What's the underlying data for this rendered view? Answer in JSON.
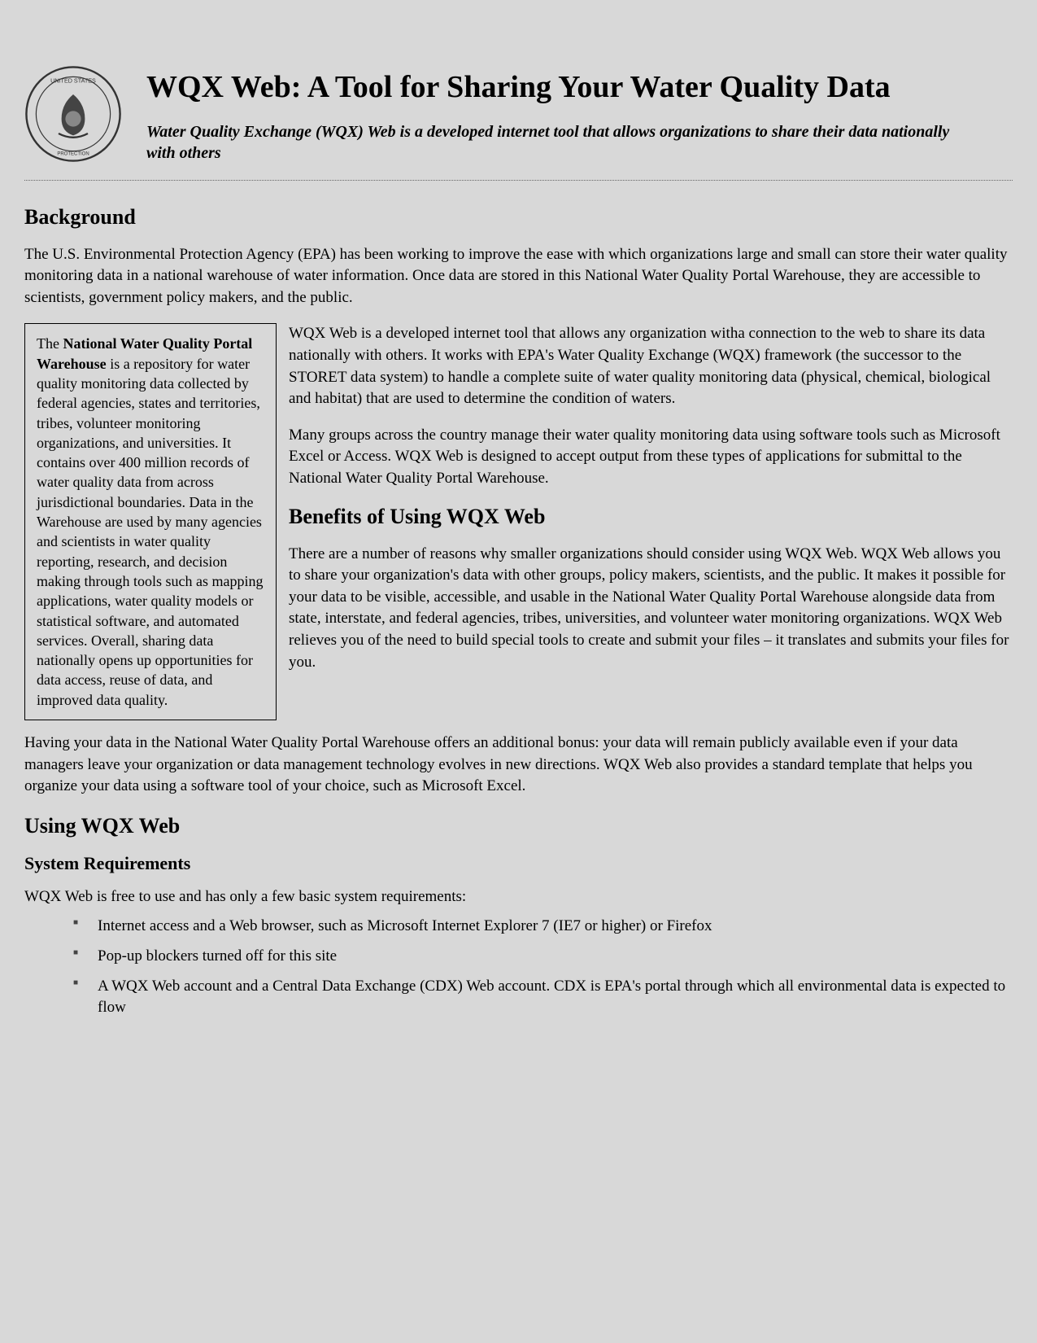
{
  "header": {
    "title": "WQX Web: A Tool for Sharing Your Water Quality Data",
    "subtitle": "Water Quality Exchange (WQX) Web is a developed internet tool that allows organizations to share their data nationally with others"
  },
  "background": {
    "heading": "Background",
    "intro": "The U.S. Environmental Protection Agency (EPA) has been working to improve the ease with which organizations large and small can store their water quality monitoring data in a national warehouse of water information. Once data are stored in this National Water Quality Portal Warehouse, they are accessible to scientists, government policy makers, and the public.",
    "callout_bold": "National Water Quality Portal Warehouse",
    "callout_before": "The ",
    "callout_after": " is a repository for water quality monitoring data collected by federal agencies, states and territories, tribes, volunteer monitoring organizations, and universities. It contains over 400 million records of water quality data from across jurisdictional boundaries. Data in the Warehouse are used by many agencies and scientists in water quality reporting, research, and decision making through tools such as mapping applications, water quality models or statistical software, and automated services. Overall, sharing data nationally opens up opportunities for data access, reuse of data, and improved data quality.",
    "para1": "WQX Web is a developed internet tool that allows any organization witha connection to the web to share its data nationally with others. It works with EPA's Water Quality Exchange (WQX) framework (the successor to the STORET data system) to handle a complete suite of water quality monitoring data (physical, chemical, biological and habitat) that are used to determine the condition of waters.",
    "para2": "Many groups across the country manage their water quality monitoring data using software tools such as Microsoft Excel or Access. WQX Web is designed to accept output from these types of applications for submittal to the National Water Quality Portal Warehouse."
  },
  "benefits": {
    "heading": "Benefits of Using WQX Web",
    "para1": "There are a number of reasons why smaller organizations should consider using WQX Web. WQX Web allows you to share your organization's data with other groups, policy makers, scientists, and the public. It makes it possible for your data to be visible, accessible, and usable in the National Water Quality Portal Warehouse alongside data from state, interstate, and federal agencies, tribes, universities, and volunteer water monitoring organizations.  WQX Web relieves you of the need to build special tools to create and submit your files – it translates and submits your files for you.",
    "para2": "Having your data in the National Water Quality Portal Warehouse offers an additional bonus: your data will remain publicly available even if your data managers leave your organization or data management technology evolves in new directions. WQX Web also provides a standard template that helps you organize your data using a software tool of your choice, such as Microsoft Excel."
  },
  "using": {
    "heading": "Using WQX Web",
    "subheading": "System Requirements",
    "intro": "WQX Web is free to use and has only a few basic system requirements:",
    "reqs": [
      "Internet access and a Web browser, such as Microsoft Internet Explorer 7 (IE7 or higher) or Firefox",
      "Pop-up blockers turned off for this site",
      "A WQX Web account and a Central Data Exchange (CDX) Web account. CDX is EPA's portal through which all environmental data is expected to flow"
    ]
  }
}
